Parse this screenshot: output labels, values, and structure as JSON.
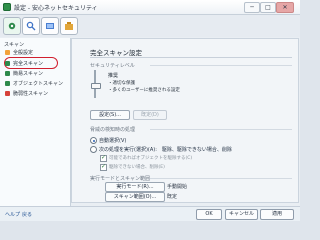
{
  "window": {
    "title": "設定 - 安心ネットセキュリティ"
  },
  "window_buttons": {
    "minimize": "─",
    "maximize": "□",
    "close": "✕"
  },
  "toolbar": {
    "icons": [
      "settings-icon",
      "search-icon",
      "update-icon",
      "tools-icon"
    ],
    "active": "settings-icon"
  },
  "sidebar": {
    "header": "スキャン",
    "items": [
      {
        "label": "全般設定",
        "icon": "gear",
        "color": "#f2a23a"
      },
      {
        "label": "完全スキャン",
        "icon": "scan-full",
        "color": "#2e8a4b",
        "active": true
      },
      {
        "label": "簡易スキャン",
        "icon": "scan-quick",
        "color": "#2e8a4b"
      },
      {
        "label": "オブジェクトスキャン",
        "icon": "scan-object",
        "color": "#2e8a4b"
      },
      {
        "label": "脆弱性スキャン",
        "icon": "scan-vuln",
        "color": "#d6413a"
      }
    ]
  },
  "main": {
    "title": "完全スキャン設定",
    "security_level": {
      "section_title": "セキュリティレベル",
      "level": "推奨",
      "lines": [
        "・適切な保護",
        "・多くのユーザーに推奨される設定"
      ],
      "settings_button": "設定(S)...",
      "default_button": "既定(D)"
    },
    "threat_action": {
      "section_title": "脅威の検知時の処理",
      "options": [
        {
          "label": "自動選択(V)",
          "checked": true
        },
        {
          "label": "次の処理を実行(選択)(A):　駆除、駆除できない場合、削除",
          "checked": false
        }
      ],
      "checkboxes": [
        {
          "label": "可能であればオブジェクトを駆除する(C)",
          "checked": true
        },
        {
          "label": "駆除できない場合、削除(E)",
          "checked": true
        }
      ]
    },
    "run_mode": {
      "section_title": "実行モードとスキャン範囲",
      "buttons": [
        {
          "label": "実行モード(R)...",
          "caption": "手動開始"
        },
        {
          "label": "スキャン範囲(O)...",
          "caption": "既定"
        }
      ]
    }
  },
  "footer": {
    "help": "ヘルプ",
    "about": "戻る",
    "ok": "OK",
    "cancel": "キャンセル",
    "apply": "適用"
  }
}
